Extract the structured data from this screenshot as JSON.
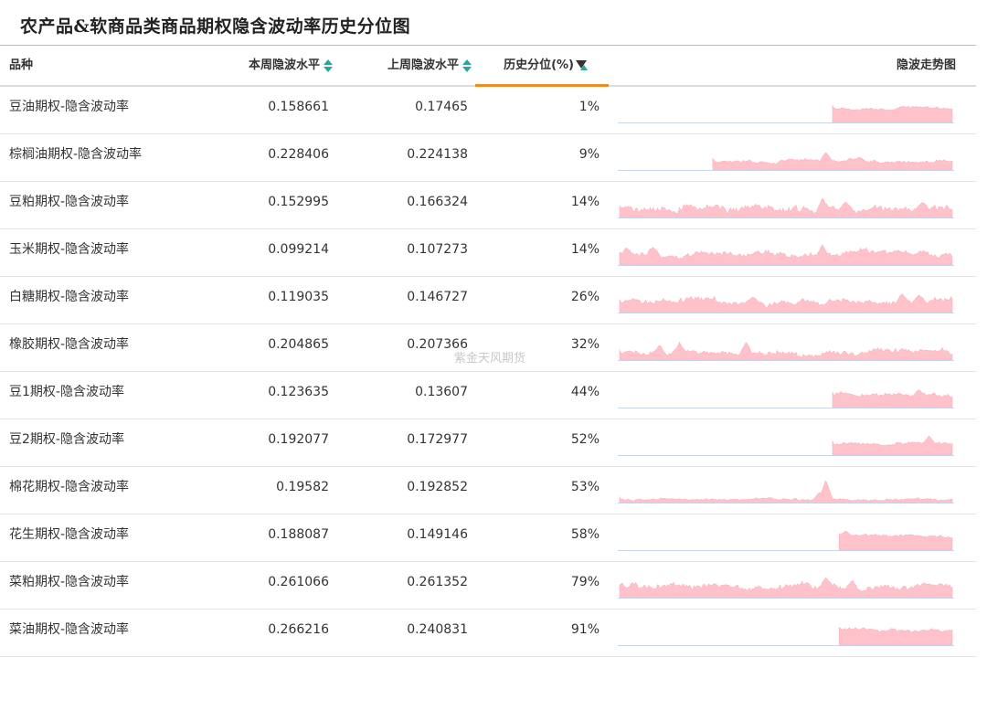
{
  "title": "农产品&软商品类商品期权隐含波动率历史分位图",
  "watermark": "紫金天风期货",
  "header": {
    "name": "品种",
    "current": "本周隐波水平",
    "previous": "上周隐波水平",
    "percentile": "历史分位(%)",
    "trend": "隐波走势图"
  },
  "colors": {
    "accent": "#f08a24",
    "sort": "#2aa69c",
    "spark_fill": "#ffc2cb",
    "spark_line": "#ffb0bd",
    "spark_base": "#c8d4e8"
  },
  "rows": [
    {
      "name": "豆油期权-隐含波动率",
      "current": "0.158661",
      "previous": "0.17465",
      "percentile": "1%",
      "spark": {
        "start": 0.64,
        "level": 0.55,
        "var": 0.12,
        "spikes": []
      }
    },
    {
      "name": "棕榈油期权-隐含波动率",
      "current": "0.228406",
      "previous": "0.224138",
      "percentile": "9%",
      "spark": {
        "start": 0.28,
        "level": 0.35,
        "var": 0.15,
        "spikes": [
          [
            0.62,
            0.7
          ],
          [
            0.72,
            0.5
          ]
        ]
      }
    },
    {
      "name": "豆粕期权-隐含波动率",
      "current": "0.152995",
      "previous": "0.166324",
      "percentile": "14%",
      "spark": {
        "start": 0.0,
        "level": 0.35,
        "var": 0.35,
        "spikes": [
          [
            0.61,
            0.75
          ],
          [
            0.68,
            0.6
          ],
          [
            0.91,
            0.6
          ]
        ]
      }
    },
    {
      "name": "玉米期权-隐含波动率",
      "current": "0.099214",
      "previous": "0.107273",
      "percentile": "14%",
      "spark": {
        "start": 0.0,
        "level": 0.4,
        "var": 0.3,
        "spikes": [
          [
            0.02,
            0.7
          ],
          [
            0.1,
            0.7
          ],
          [
            0.61,
            0.8
          ],
          [
            0.83,
            0.55
          ]
        ]
      }
    },
    {
      "name": "白糖期权-隐含波动率",
      "current": "0.119035",
      "previous": "0.146727",
      "percentile": "26%",
      "spark": {
        "start": 0.0,
        "level": 0.4,
        "var": 0.3,
        "spikes": [
          [
            0.04,
            0.55
          ],
          [
            0.4,
            0.6
          ],
          [
            0.85,
            0.75
          ],
          [
            0.9,
            0.7
          ]
        ]
      }
    },
    {
      "name": "橡胶期权-隐含波动率",
      "current": "0.204865",
      "previous": "0.207366",
      "percentile": "32%",
      "spark": {
        "start": 0.0,
        "level": 0.3,
        "var": 0.28,
        "spikes": [
          [
            0.12,
            0.6
          ],
          [
            0.18,
            0.7
          ],
          [
            0.38,
            0.72
          ]
        ]
      }
    },
    {
      "name": "豆1期权-隐含波动率",
      "current": "0.123635",
      "previous": "0.13607",
      "percentile": "44%",
      "spark": {
        "start": 0.64,
        "level": 0.5,
        "var": 0.2,
        "spikes": [
          [
            0.9,
            0.7
          ]
        ]
      }
    },
    {
      "name": "豆2期权-隐含波动率",
      "current": "0.192077",
      "previous": "0.172977",
      "percentile": "52%",
      "spark": {
        "start": 0.64,
        "level": 0.45,
        "var": 0.15,
        "spikes": [
          [
            0.93,
            0.75
          ]
        ]
      }
    },
    {
      "name": "棉花期权-隐含波动率",
      "current": "0.19582",
      "previous": "0.192852",
      "percentile": "53%",
      "spark": {
        "start": 0.0,
        "level": 0.12,
        "var": 0.1,
        "spikes": [
          [
            0.62,
            0.9
          ],
          [
            0.6,
            0.4
          ]
        ]
      }
    },
    {
      "name": "花生期权-隐含波动率",
      "current": "0.188087",
      "previous": "0.149146",
      "percentile": "58%",
      "spark": {
        "start": 0.66,
        "level": 0.55,
        "var": 0.15,
        "spikes": [
          [
            0.68,
            0.75
          ]
        ]
      }
    },
    {
      "name": "菜粕期权-隐含波动率",
      "current": "0.261066",
      "previous": "0.261352",
      "percentile": "79%",
      "spark": {
        "start": 0.0,
        "level": 0.4,
        "var": 0.3,
        "spikes": [
          [
            0.62,
            0.8
          ],
          [
            0.7,
            0.7
          ]
        ]
      }
    },
    {
      "name": "菜油期权-隐含波动率",
      "current": "0.266216",
      "previous": "0.240831",
      "percentile": "91%",
      "spark": {
        "start": 0.66,
        "level": 0.6,
        "var": 0.15,
        "spikes": []
      }
    }
  ]
}
